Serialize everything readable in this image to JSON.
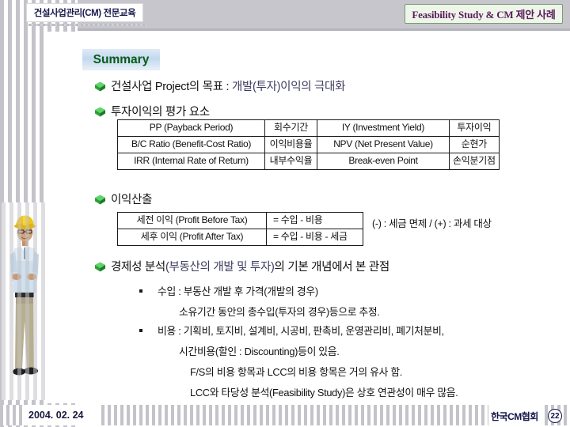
{
  "header": {
    "left_title": "건설사업관리(CM) 전문교육",
    "right_title": "Feasibility Study & CM 제안 사례"
  },
  "summary": {
    "heading": "Summary"
  },
  "bullets": {
    "b1_black": "건설사업 Project의 목표 : ",
    "b1_accent": "개발(투자)이익의 극대화",
    "b2": "투자이익의 평가 요소",
    "b3": "이익산출",
    "b4_pre": "경제성 분석",
    "b4_accent": "(부동산의 개발 및 투자)",
    "b4_post": "의 기본 개념에서 본 관점"
  },
  "table_metrics": {
    "rows": [
      {
        "c1": "PP (Payback Period)",
        "c2": "회수기간",
        "c3": "IY (Investment Yield)",
        "c4": "투자이익"
      },
      {
        "c1": "B/C Ratio (Benefit-Cost Ratio)",
        "c2": "이익비용율",
        "c3": "NPV (Net Present Value)",
        "c4": "순현가"
      },
      {
        "c1": "IRR (Internal Rate of Return)",
        "c2": "내부수익율",
        "c3": "Break-even Point",
        "c4": "손익분기점"
      }
    ]
  },
  "table_profit": {
    "rows": [
      {
        "p1": "세전 이익 (Profit Before Tax)",
        "p2": "= 수입 - 비용"
      },
      {
        "p1": "세후 이익 (Profit After Tax)",
        "p2": "= 수입 - 비용 - 세금"
      }
    ],
    "note": "(-) : 세금 면제 / (+) : 과세 대상"
  },
  "sub_items": [
    "수입 : 부동산 개발 후 가격(개발의 경우)",
    "소유기간 동안의 총수입(투자의 경우)등으로 추정.",
    "비용 : 기획비, 토지비, 설계비, 시공비, 판촉비, 운영관리비, 폐기처분비,",
    "시간비용(할인 : Discounting)등이 있음.",
    "F/S의 비용 항목과 LCC의 비용 항목은 거의 유사 함.",
    "LCC와 타당성 분석(Feasibility Study)은 상호 연관성이 매우 많음."
  ],
  "footer": {
    "date": "2004. 02. 24",
    "org": "한국CM협회",
    "page": "22"
  },
  "colors": {
    "header_band": "#c6c6cc",
    "left_title_text": "#1a1a4e",
    "right_title_text": "#5b1c5b",
    "right_title_bg": "#eef6ea",
    "summary_text": "#0a5a19",
    "accent_text": "#3b3b5e",
    "bullet_gem": "#2a9b32"
  }
}
